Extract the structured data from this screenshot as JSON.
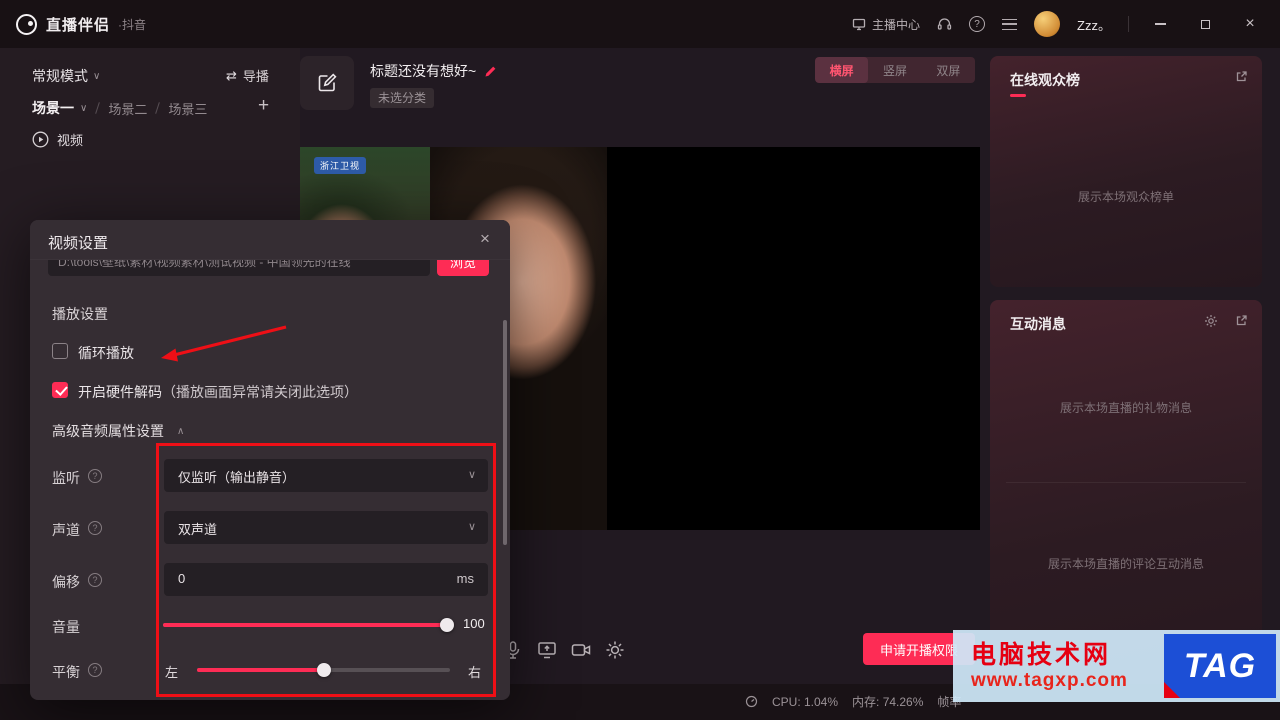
{
  "icons": {
    "caret_down": "∨",
    "caret_up": "∧",
    "close": "×",
    "plus": "+",
    "swap": "⇄",
    "help": "?",
    "info": "?"
  },
  "titlebar": {
    "app_name": "直播伴侣",
    "app_suffix": "·抖音",
    "anchor_center": "主播中心",
    "username": "Zzz。"
  },
  "left_panel": {
    "mode_label": "常规模式",
    "director_label": "导播",
    "scenes": [
      {
        "label": "场景一"
      },
      {
        "label": "场景二"
      },
      {
        "label": "场景三"
      }
    ],
    "video_item_label": "视频"
  },
  "main": {
    "title": "标题还没有想好~",
    "category": "未选分类",
    "orientation": {
      "landscape": "横屏",
      "portrait": "竖屏",
      "dual": "双屏"
    },
    "tv_badge": "浙江卫视",
    "request_button": "申请开播权限",
    "status": {
      "cpu": "CPU: 1.04%",
      "memory": "内存: 74.26%",
      "fps": "帧率"
    }
  },
  "modal": {
    "title": "视频设置",
    "file_path": "D:\\tools\\壁纸\\素材\\视频素材\\测试视频 - 中国领先的在线",
    "browse_label": "浏览",
    "play_settings_title": "播放设置",
    "loop_label": "循环播放",
    "hardware_label": "开启硬件解码",
    "hardware_note": "（播放画面异常请关闭此选项）",
    "advanced_title": "高级音频属性设置",
    "rows": {
      "monitor": {
        "label": "监听",
        "value": "仅监听（输出静音）"
      },
      "channel": {
        "label": "声道",
        "value": "双声道"
      },
      "offset": {
        "label": "偏移",
        "value": "0",
        "unit": "ms"
      },
      "volume": {
        "label": "音量",
        "value": "100"
      },
      "balance": {
        "label": "平衡",
        "left": "左",
        "right": "右"
      }
    }
  },
  "right_panel": {
    "audience": {
      "title": "在线观众榜",
      "placeholder": "展示本场观众榜单"
    },
    "interaction": {
      "title": "互动消息",
      "gift_placeholder": "展示本场直播的礼物消息",
      "comment_placeholder": "展示本场直播的评论互动消息"
    }
  },
  "watermark": {
    "site_name": "电脑技术网",
    "site_url": "www.tagxp.com",
    "logo": "TAG"
  },
  "colors": {
    "accent": "#fe2c55",
    "annotation": "#ee0f16"
  }
}
